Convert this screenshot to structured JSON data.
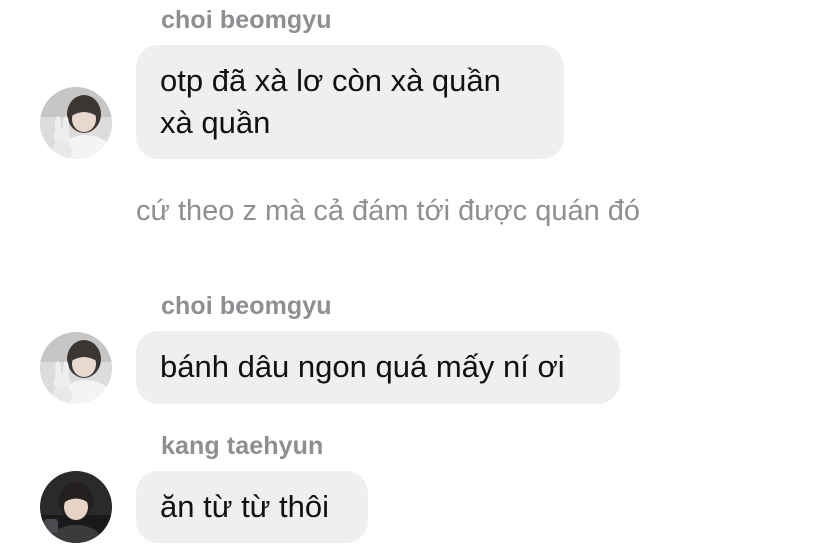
{
  "messages": [
    {
      "type": "sender",
      "name": "choi beomgyu"
    },
    {
      "type": "bubble",
      "text": "otp đã xà lơ còn xà quần\nxà quần",
      "avatar": "beomgyu-avatar"
    },
    {
      "type": "system",
      "text": "cứ theo z mà cả đám tới được quán đó"
    },
    {
      "type": "sender",
      "name": "choi beomgyu"
    },
    {
      "type": "bubble",
      "text": "bánh dâu ngon quá mấy ní ơi",
      "avatar": "beomgyu-avatar"
    },
    {
      "type": "sender",
      "name": "kang taehyun"
    },
    {
      "type": "bubble",
      "text": "ăn từ từ thôi",
      "avatar": "taehyun-avatar"
    }
  ],
  "colors": {
    "bubble_bg": "#efeff0",
    "sender_text": "#8e8e93",
    "message_text": "#111111",
    "background": "#ffffff"
  }
}
